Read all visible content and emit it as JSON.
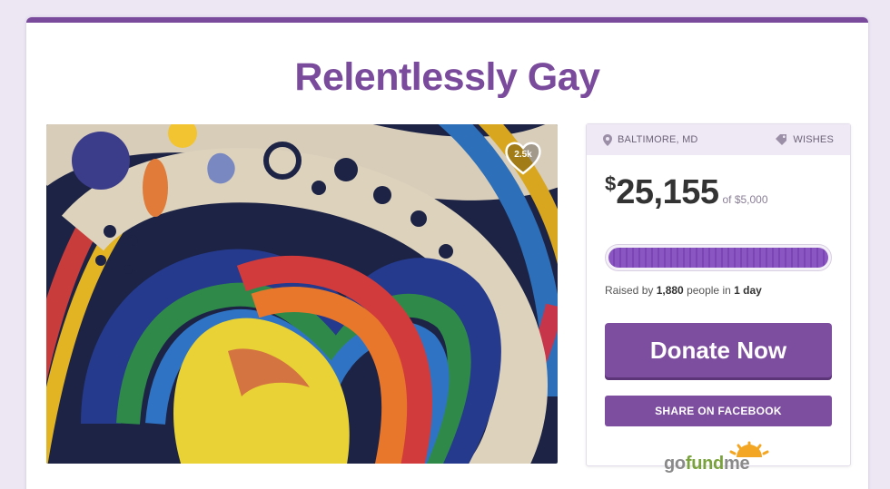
{
  "campaign": {
    "title": "Relentlessly Gay",
    "likes_badge": "2.5k"
  },
  "panel": {
    "location": "BALTIMORE, MD",
    "category": "WISHES",
    "currency_symbol": "$",
    "raised_amount": "25,155",
    "goal_text": "of $5,000",
    "progress_fraction": 1.0,
    "raised_prefix": "Raised by ",
    "people_count": "1,880",
    "people_mid": " people in ",
    "duration": "1 day",
    "donate_label": "Donate Now",
    "share_label": "SHARE ON FACEBOOK"
  },
  "logo": {
    "go": "go",
    "fund": "fund",
    "me": "me"
  },
  "colors": {
    "brand_purple": "#7a4a9c",
    "progress_purple": "#8a56c2",
    "logo_green": "#7aa23c",
    "logo_sun": "#f2a623"
  },
  "icons": {
    "location": "map-pin-icon",
    "category": "tag-icon",
    "favorite": "heart-icon"
  }
}
